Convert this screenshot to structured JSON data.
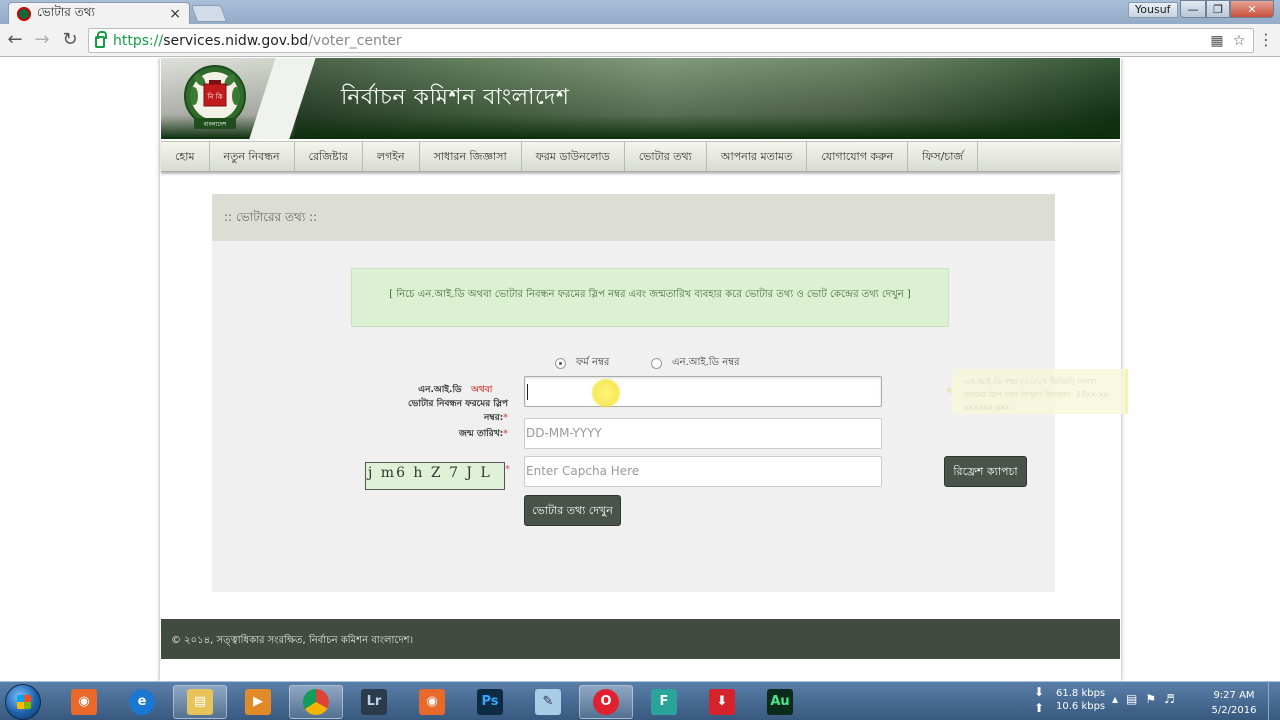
{
  "browser": {
    "tab_title": "ভোটার তথ্য",
    "tab_close": "×",
    "user_name": "Yousuf",
    "window_controls": {
      "minimize": "—",
      "maximize": "❐",
      "close": "✕"
    },
    "url_scheme": "https://",
    "url_host": "services.nidw.gov.bd",
    "url_path": "/voter_center",
    "icons": {
      "back": "arrow-left",
      "forward": "arrow-right",
      "reload": "reload",
      "lock": "lock",
      "translate": "translate",
      "star": "star",
      "menu": "hamburger"
    }
  },
  "site": {
    "title": "নির্বাচন কমিশন বাংলাদেশ",
    "logo_caption": "বাংলাদেশ",
    "nav": [
      "হোম",
      "নতুন নিবন্ধন",
      "রেজিষ্টার",
      "লগইন",
      "সাধারন জিজ্ঞাসা",
      "ফরম ডাউনলোড",
      "ভোটার তথ্য",
      "আপনার মতামত",
      "যোগাযোগ করুন",
      "ফিস/চার্জ"
    ]
  },
  "form": {
    "section_title": ":: ভোটারের তথ্য ::",
    "info_text": "[ নিচে এন.আই.ডি অথবা ভোটার নিবন্ধন ফরমের স্লিপ নম্বর এবং জন্মতারিখ ব্যবহার করে ভোটার তথ্য ও ভোট কেন্দ্রের তথ্য দেখুন ]",
    "radio_form_number": "ফর্ম নম্বর",
    "radio_nid_number": "এন.আই.ডি নম্বর",
    "selected_radio": "form_number",
    "id_label_line1": "এন.আই.ডি",
    "id_label_or": "অথবা",
    "id_label_line2": "ভোটার নিবন্ধন ফরমের স্লিপ নম্বর:",
    "id_value": "",
    "dob_label": "জন্ম তারিখ:",
    "dob_placeholder": "DD-MM-YYYY",
    "captcha_text": "j m6 h Z 7 J L",
    "captcha_placeholder": "Enter Capcha Here",
    "required_mark": "*",
    "refresh_button": "রিফ্রেশ ক্যাপচা",
    "submit_button": "ভোটার তথ্য দেখুন",
    "tooltip_text": "এন.আই.ডি নম্বর (১৩/১৭ ডিজিট) অথবা ফরমের স্লিপ নম্বর লিখুন। উদাহরণ: 19xx-xx-xxxxxx-xxx"
  },
  "footer": {
    "copyright": "© ২০১৪, সত্ত্বাধিকার সংরক্ষিত, নির্বাচন কমিশন বাংলাদেশ।"
  },
  "taskbar": {
    "apps": [
      "file-explorer-camera",
      "internet-explorer",
      "windows-explorer",
      "media-player",
      "google-chrome",
      "lightroom",
      "snipping-tool",
      "photoshop",
      "notepad",
      "opera",
      "flash",
      "downloader",
      "audition"
    ],
    "app_labels": {
      "lightroom": "Lr",
      "photoshop": "Ps",
      "flash": "F",
      "audition": "Au"
    },
    "net_down": "61.8 kbps",
    "net_up": "10.6 kbps",
    "time": "9:27 AM",
    "date": "5/2/2016"
  }
}
